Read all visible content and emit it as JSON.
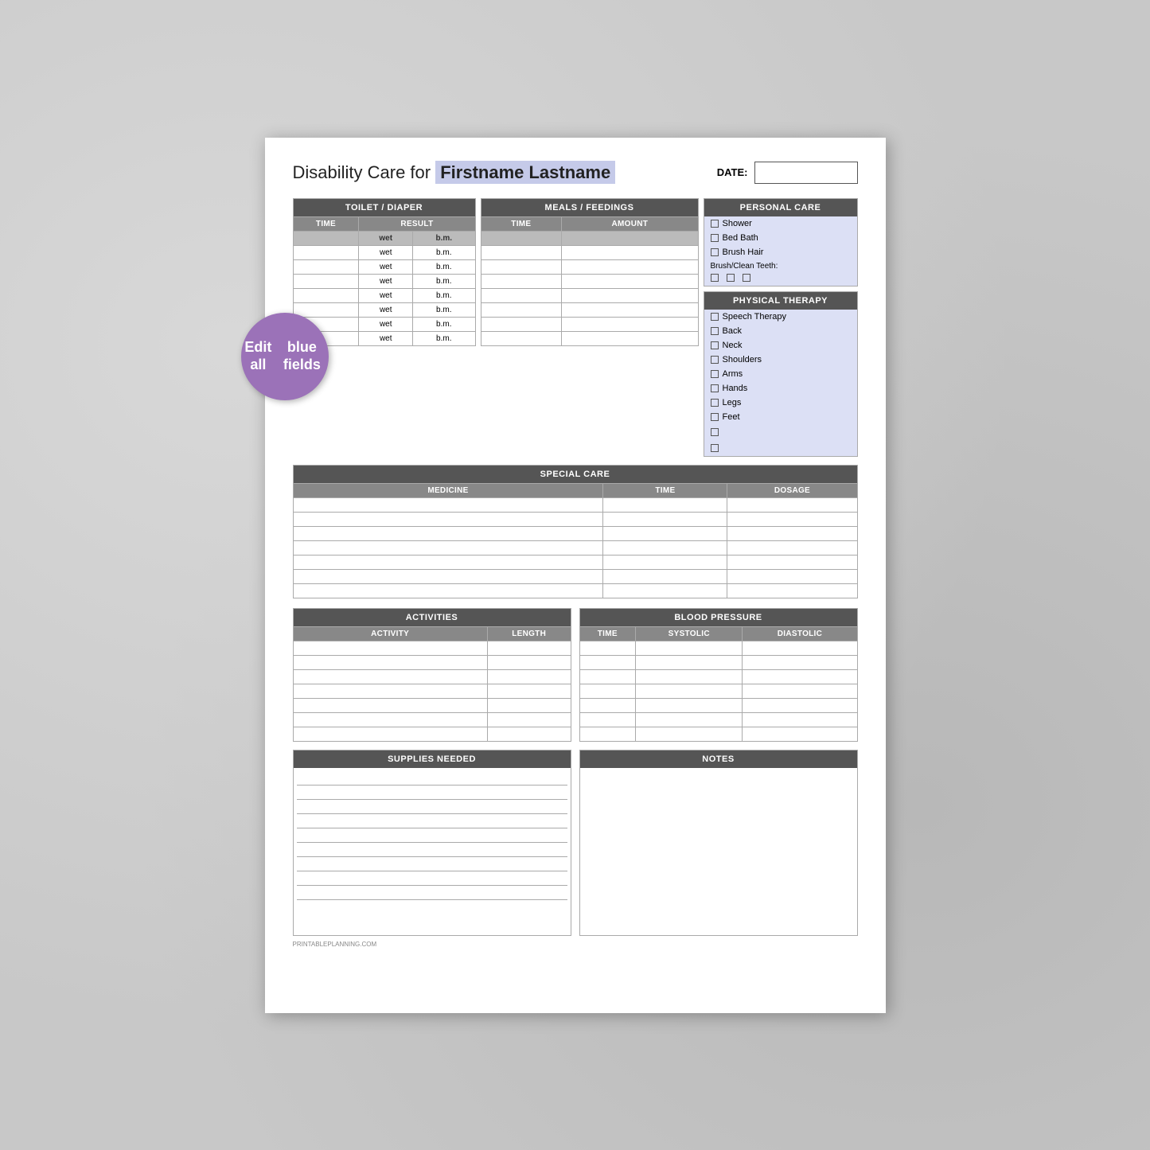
{
  "title": {
    "prefix": "Disability Care for",
    "name": "Firstname Lastname",
    "date_label": "DATE:"
  },
  "toilet_diaper": {
    "header": "TOILET / DIAPER",
    "col_time": "TIME",
    "col_result": "RESULT",
    "col_wet": "wet",
    "col_bm": "b.m.",
    "rows": 7
  },
  "meals_feedings": {
    "header": "MEALS / FEEDINGS",
    "col_time": "TIME",
    "col_amount": "AMOUNT",
    "rows": 7
  },
  "personal_care": {
    "header": "PERSONAL CARE",
    "items": [
      "Shower",
      "Bed Bath",
      "Brush Hair"
    ],
    "brush_teeth_label": "Brush/Clean Teeth:",
    "brush_teeth_count": 3
  },
  "physical_therapy": {
    "header": "PHYSICAL THERAPY",
    "items": [
      "Speech Therapy",
      "Back",
      "Neck",
      "Shoulders",
      "Arms",
      "Hands",
      "Legs",
      "Feet",
      "",
      ""
    ]
  },
  "special_care": {
    "header": "SPECIAL CARE",
    "col_medicine": "MEDICINE",
    "col_time": "TIME",
    "col_dosage": "DOSAGE",
    "rows": 7
  },
  "activities": {
    "header": "ACTIVITIES",
    "col_activity": "ACTIVITY",
    "col_length": "LENGTH",
    "rows": 7
  },
  "blood_pressure": {
    "header": "BLOOD PRESSURE",
    "col_time": "TIME",
    "col_systolic": "SYSTOLIC",
    "col_diastolic": "DIASTOLIC",
    "rows": 7
  },
  "supplies": {
    "header": "SUPPLIES NEEDED",
    "rows": 10
  },
  "notes": {
    "header": "NOTES"
  },
  "edit_badge": {
    "line1": "Edit all",
    "line2": "blue fields"
  },
  "footer": "PRINTABLEPLANNING.COM"
}
